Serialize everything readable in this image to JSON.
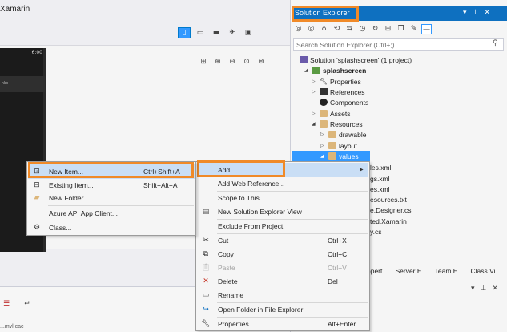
{
  "designer": {
    "title": "Xamarin",
    "toolbar_icons": [
      "device-view-icon",
      "layout-icon",
      "battery-icon",
      "pin-icon",
      "grid-icon"
    ],
    "zoom_icons": [
      "fit-icon",
      "zoom-in-icon",
      "zoom-out-icon",
      "zoom-reset-icon",
      "zoom-actual-icon"
    ],
    "device_time": "6:00",
    "device_appbar_text": "nkb"
  },
  "solution_explorer": {
    "title": "Solution Explorer",
    "search_placeholder": "Search Solution Explorer (Ctrl+;)",
    "tree": [
      {
        "label": "Solution 'splashscreen' (1 project)",
        "icon": "solution-icon"
      },
      {
        "label": "splashscreen",
        "icon": "project-icon",
        "bold": true
      },
      {
        "label": "Properties",
        "icon": "wrench-icon"
      },
      {
        "label": "References",
        "icon": "references-icon"
      },
      {
        "label": "Components",
        "icon": "components-icon"
      },
      {
        "label": "Assets",
        "icon": "folder-icon"
      },
      {
        "label": "Resources",
        "icon": "folder-icon"
      },
      {
        "label": "drawable",
        "icon": "folder-icon"
      },
      {
        "label": "layout",
        "icon": "folder-icon"
      },
      {
        "label": "values",
        "icon": "folder-icon",
        "selected": true
      }
    ],
    "file_fragments": [
      "les.xml",
      "gs.xml",
      "es.xml",
      "esources.txt",
      "e.Designer.cs",
      "ted.Xamarin",
      "y.cs"
    ],
    "bottom_tabs": [
      "opert...",
      "Server E...",
      "Team E...",
      "Class Vi..."
    ]
  },
  "main_menu": {
    "items": [
      {
        "label": "Add",
        "shortcut": "",
        "icon": "",
        "submenu": true
      },
      {
        "label": "Add Web Reference...",
        "shortcut": "",
        "icon": ""
      },
      {
        "label": "Scope to This",
        "shortcut": "",
        "icon": ""
      },
      {
        "label": "New Solution Explorer View",
        "shortcut": "",
        "icon": "new-view-icon"
      },
      {
        "label": "Exclude From Project",
        "shortcut": "",
        "icon": ""
      },
      {
        "label": "Cut",
        "shortcut": "Ctrl+X",
        "icon": "cut-icon"
      },
      {
        "label": "Copy",
        "shortcut": "Ctrl+C",
        "icon": "copy-icon"
      },
      {
        "label": "Paste",
        "shortcut": "Ctrl+V",
        "icon": "paste-icon",
        "disabled": true
      },
      {
        "label": "Delete",
        "shortcut": "Del",
        "icon": "delete-icon"
      },
      {
        "label": "Rename",
        "shortcut": "",
        "icon": "rename-icon"
      },
      {
        "label": "Open Folder in File Explorer",
        "shortcut": "",
        "icon": "open-folder-icon"
      },
      {
        "label": "Properties",
        "shortcut": "Alt+Enter",
        "icon": "wrench-icon"
      }
    ]
  },
  "add_menu": {
    "items": [
      {
        "label": "New Item...",
        "shortcut": "Ctrl+Shift+A",
        "icon": "new-item-icon"
      },
      {
        "label": "Existing Item...",
        "shortcut": "Shift+Alt+A",
        "icon": "existing-item-icon"
      },
      {
        "label": "New Folder",
        "shortcut": "",
        "icon": "new-folder-icon"
      },
      {
        "label": "Azure API App Client...",
        "shortcut": "",
        "icon": ""
      },
      {
        "label": "Class...",
        "shortcut": "",
        "icon": "class-icon"
      }
    ]
  },
  "output": {
    "bottom_text": "...mvl cac"
  },
  "colors": {
    "highlight": "#f08a28",
    "selection": "#3399ff",
    "titlebar": "#0e70c0",
    "menu_hover": "#c9def5"
  }
}
